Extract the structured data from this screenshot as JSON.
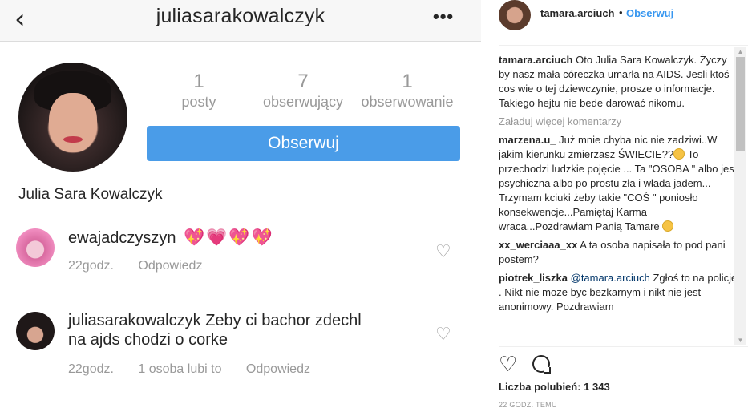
{
  "screenshot": {
    "header": {
      "back_icon": "chevron-left-icon",
      "title": "juliasarakowalczyk",
      "more_icon": "more-horizontal-icon"
    },
    "stats": [
      {
        "value": "1",
        "label": "posty"
      },
      {
        "value": "7",
        "label": "obserwujący"
      },
      {
        "value": "1",
        "label": "obserwowanie"
      }
    ],
    "follow_button": "Obserwuj",
    "full_name": "Julia Sara Kowalczyk",
    "comments": [
      {
        "user": "ewajadczyszyn",
        "text": "",
        "emoji": "💖💗💖💖",
        "time": "22godz.",
        "likes": "",
        "reply": "Odpowiedz"
      },
      {
        "user": "juliasarakowalczyk",
        "text": "Zeby ci bachor zdechl",
        "text2": "na ajds chodzi o corke",
        "time": "22godz.",
        "likes": "1 osoba lubi to",
        "reply": "Odpowiedz"
      }
    ],
    "heart_icon": "heart-outline-icon"
  },
  "post": {
    "username": "tamara.arciuch",
    "dot": "•",
    "follow": "Obserwuj",
    "caption_user": "tamara.arciuch",
    "caption": "Oto Julia Sara Kowalczyk. Życzy by nasz mała córeczka umarła na AIDS. Jesli ktoś cos wie o tej dziewczynie, prosze o informacje. Takiego hejtu nie bede darować nikomu.",
    "load_more": "Załaduj więcej komentarzy",
    "comments": [
      {
        "user": "marzena.u_",
        "text_a": "Już mnie chyba nic nie zadziwi..W jakim kierunku zmierzasz ŚWIECIE??",
        "text_b": "To przechodzi ludzkie pojęcie ... Ta \"OSOBA \" albo jest psychiczna albo po prostu zła i włada jadem... Trzymam kciuki żeby takie \"COŚ \" poniosło konsekwencje...Pamiętaj Karma wraca...Pozdrawiam Panią Tamare"
      },
      {
        "user": "xx_werciaaa_xx",
        "text": "A ta osoba napisała to pod pani postem?"
      },
      {
        "user": "piotrek_liszka",
        "mention": "@tamara.arciuch",
        "text": "Zgłoś to na policję . Nikt nie moze byc bezkarnym i nikt nie jest anonimowy. Pozdrawiam"
      }
    ],
    "likes": "Liczba polubień: 1 343",
    "time": "22 godz. temu"
  }
}
